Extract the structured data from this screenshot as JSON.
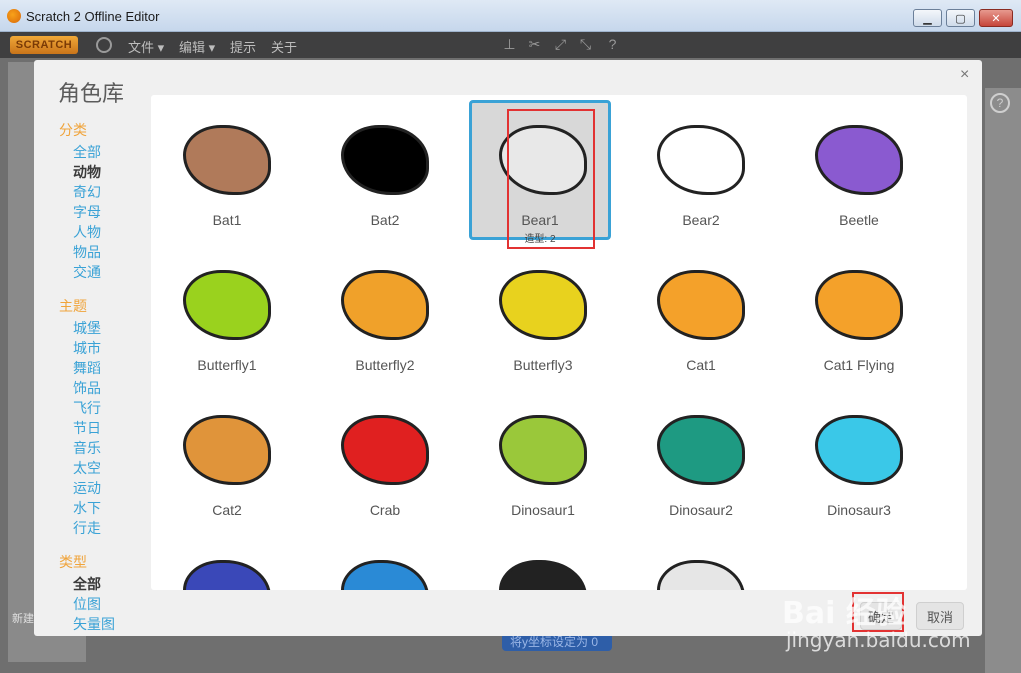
{
  "window": {
    "title": "Scratch 2 Offline Editor",
    "close_glyph": "✕",
    "min_glyph": "▁",
    "max_glyph": "▢"
  },
  "menubar": {
    "logo": "SCRATCH",
    "items": [
      "文件 ▾",
      "编辑 ▾",
      "提示",
      "关于"
    ]
  },
  "background": {
    "block_text": "将y坐标设定为 0",
    "new_label": "新建"
  },
  "dialog": {
    "title": "角色库",
    "close": "×",
    "category_heading": "分类",
    "categories": [
      "全部",
      "动物",
      "奇幻",
      "字母",
      "人物",
      "物品",
      "交通"
    ],
    "selected_category": "动物",
    "theme_heading": "主题",
    "themes": [
      "城堡",
      "城市",
      "舞蹈",
      "饰品",
      "飞行",
      "节日",
      "音乐",
      "太空",
      "运动",
      "水下",
      "行走"
    ],
    "type_heading": "类型",
    "types": [
      "全部",
      "位图",
      "矢量图"
    ],
    "selected_type": "全部",
    "ok_label": "确定",
    "cancel_label": "取消"
  },
  "sprites": [
    {
      "name": "Bat1",
      "color": "#b07a5a"
    },
    {
      "name": "Bat2",
      "color": "#000000"
    },
    {
      "name": "Bear1",
      "color": "#e8e8e8",
      "selected": true,
      "costumes": "造型: 2"
    },
    {
      "name": "Bear2",
      "color": "#ffffff"
    },
    {
      "name": "Beetle",
      "color": "#8a5ad0"
    },
    {
      "name": "Butterfly1",
      "color": "#9ad21e"
    },
    {
      "name": "Butterfly2",
      "color": "#f0a12a"
    },
    {
      "name": "Butterfly3",
      "color": "#e8d21e"
    },
    {
      "name": "Cat1",
      "color": "#f4a12a"
    },
    {
      "name": "Cat1 Flying",
      "color": "#f4a12a"
    },
    {
      "name": "Cat2",
      "color": "#e0943a"
    },
    {
      "name": "Crab",
      "color": "#e02020"
    },
    {
      "name": "Dinosaur1",
      "color": "#9ac83a"
    },
    {
      "name": "Dinosaur2",
      "color": "#1e9a82"
    },
    {
      "name": "Dinosaur3",
      "color": "#3ac8e8"
    },
    {
      "name": "",
      "color": "#3a48b8"
    },
    {
      "name": "",
      "color": "#2a8ad6"
    },
    {
      "name": "",
      "color": "#222222"
    },
    {
      "name": "",
      "color": "#e6e6e6"
    }
  ],
  "watermark": {
    "logo": "Bai 经验",
    "url": "jingyan.baidu.com"
  }
}
